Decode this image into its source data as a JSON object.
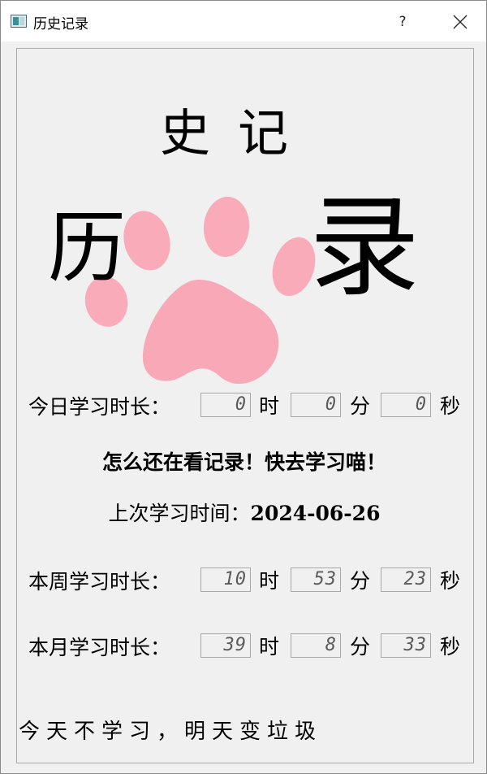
{
  "window": {
    "title": "历史记录",
    "help_label": "?"
  },
  "heading": {
    "top": "史记",
    "left_char": "历",
    "right_char": "录"
  },
  "today": {
    "label": "今日学习时长：",
    "hours": "0",
    "minutes": "0",
    "seconds": "0"
  },
  "units": {
    "hours": "时",
    "minutes": "分",
    "seconds": "秒"
  },
  "reminder": "怎么还在看记录！快去学习喵！",
  "last_study": {
    "label": "上次学习时间：",
    "date": "2024-06-26"
  },
  "week": {
    "label": "本周学习时长：",
    "hours": "10",
    "minutes": "53",
    "seconds": "23"
  },
  "month": {
    "label": "本月学习时长：",
    "hours": "39",
    "minutes": "8",
    "seconds": "33"
  },
  "slogan": "今天不学习，明天变垃圾",
  "colors": {
    "paw": "#f9a3b4",
    "lcd_text": "#5a5a5a"
  }
}
